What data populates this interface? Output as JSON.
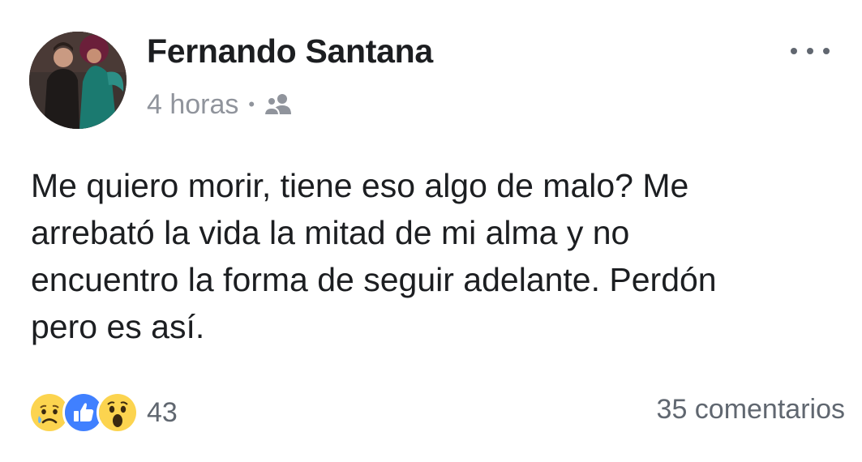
{
  "post": {
    "author": {
      "name": "Fernando Santana"
    },
    "timestamp": "4 horas",
    "separator": "•",
    "audience_icon": "friends-icon",
    "menu_icon": "more-options-icon",
    "text": "Me quiero morir, tiene eso algo de malo? Me\narrebató la vida la mitad de mi alma y no\nencuentro la forma de seguir adelante. Perdón\npero es así.",
    "reactions": {
      "icons": [
        "sad-reaction-icon",
        "like-reaction-icon",
        "wow-reaction-icon"
      ],
      "count": "43"
    },
    "comments": "35 comentarios"
  },
  "colors": {
    "like_blue": "#4080ff",
    "emoji_yellow": "#fcd44f",
    "meta_gray": "#90949c"
  }
}
